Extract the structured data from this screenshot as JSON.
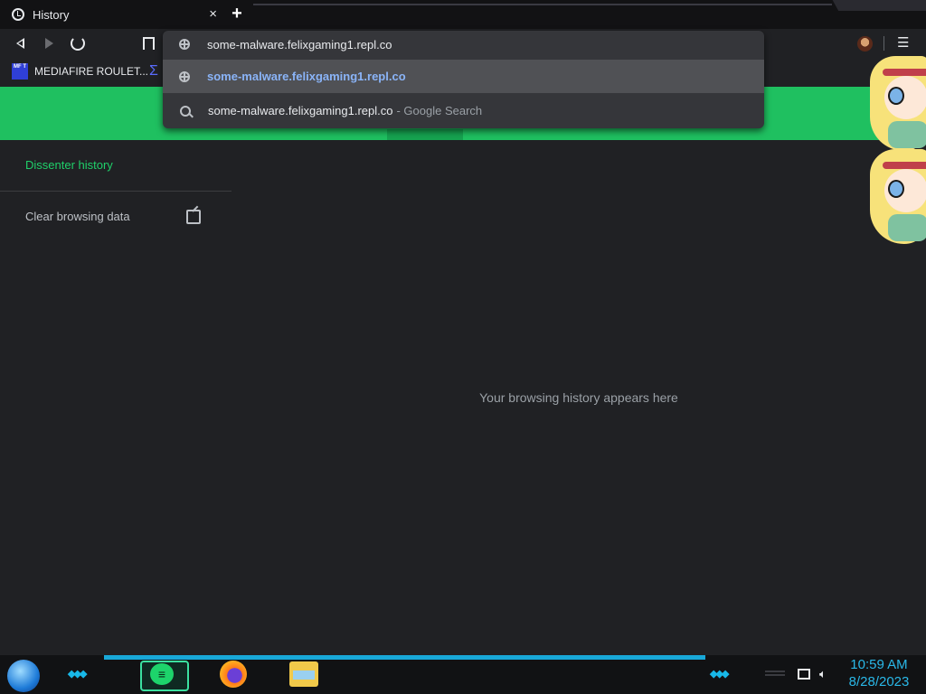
{
  "browser": {
    "tab": {
      "title": "History",
      "close": "×"
    },
    "new_tab": "+",
    "address_bar": {
      "value": "some-malware.felixgaming1.repl.co"
    },
    "menu": "☰"
  },
  "omnibox": {
    "suggestions": [
      {
        "icon": "globe-icon",
        "text": "some-malware.felixgaming1.repl.co",
        "suffix": ""
      },
      {
        "icon": "globe-icon",
        "text": "some-malware.felixgaming1.repl.co",
        "suffix": ""
      },
      {
        "icon": "search-icon",
        "text": "some-malware.felixgaming1.repl.co",
        "suffix": "- Google Search"
      }
    ]
  },
  "bookmarks": [
    {
      "favicon_text": "MF T",
      "label": "MEDIAFIRE ROULET..."
    },
    {
      "favicon_text": "Σ",
      "label": ""
    }
  ],
  "sidebar": {
    "items": [
      {
        "label": "Dissenter history",
        "active": true
      },
      {
        "label": "Clear browsing data",
        "active": false
      }
    ]
  },
  "main": {
    "empty_message": "Your browsing history appears here"
  },
  "colors": {
    "accent_green": "#1fc060",
    "link_green": "#1fd06a",
    "taskbar_blue": "#18a8d8",
    "suggestion_blue": "#8ab4f8"
  },
  "taskbar": {
    "apps": [
      "dissenter-browser",
      "firefox",
      "file-explorer"
    ],
    "clock": {
      "time": "10:59 AM",
      "date": "8/28/2023"
    }
  }
}
